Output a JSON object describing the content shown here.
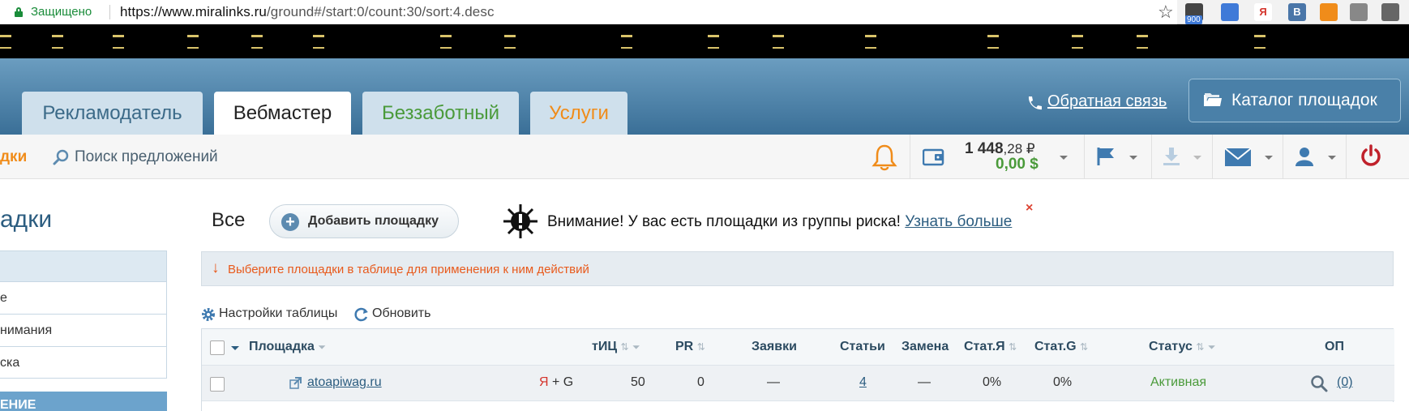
{
  "browser": {
    "secure_label": "Защищено",
    "url_host": "https://www.miralinks.ru",
    "url_path": "/ground#/start:0/count:30/sort:4.desc",
    "ext_badge": "900",
    "ext_ya": "Я",
    "ext_vk": "В"
  },
  "header": {
    "tabs": [
      {
        "label": "Рекламодатель"
      },
      {
        "label": "Вебмастер"
      },
      {
        "label": "Беззаботный"
      },
      {
        "label": "Услуги"
      }
    ],
    "feedback": "Обратная связь",
    "catalog_button": "Каталог площадок"
  },
  "toolbar": {
    "partial_label": "дки",
    "search_offers": "Поиск предложений",
    "balance_rub_main": "1 448",
    "balance_rub_cents": ",28 ₽",
    "balance_usd": "0,00 $"
  },
  "sidebar": {
    "title_partial": "адки",
    "items": [
      {
        "label": "е"
      },
      {
        "label": "нимания"
      },
      {
        "label": "ска"
      }
    ],
    "bottom_partial": "ЕНИЕ"
  },
  "main": {
    "all_label": "Все",
    "add_button": "Добавить площадку",
    "warning_text": "Внимание! У вас есть площадки из группы риска!",
    "warning_link": "Узнать больше",
    "close_label": "×",
    "info_arrow": "↓",
    "info_text": "Выберите площадки в таблице для применения к ним действий",
    "table_settings": "Настройки таблицы",
    "refresh": "Обновить"
  },
  "table": {
    "columns": [
      "Площадка",
      "тИЦ",
      "PR",
      "Заявки",
      "Статьи",
      "Замена",
      "Стат.Я",
      "Стат.G",
      "Статус",
      "ОП"
    ],
    "rows": [
      {
        "site": "atoapiwag.ru",
        "engines_ya": "Я",
        "engines_rest": "+ G",
        "tic": "50",
        "pr": "0",
        "requests": "—",
        "articles": "4",
        "replace": "—",
        "stat_ya": "0%",
        "stat_g": "0%",
        "status": "Активная",
        "op": "(0)"
      }
    ]
  },
  "colors": {
    "header_blue": "#3a6f97",
    "accent_orange": "#f08c1a",
    "accent_green": "#4a9a3a",
    "link_blue": "#2c5d80"
  }
}
